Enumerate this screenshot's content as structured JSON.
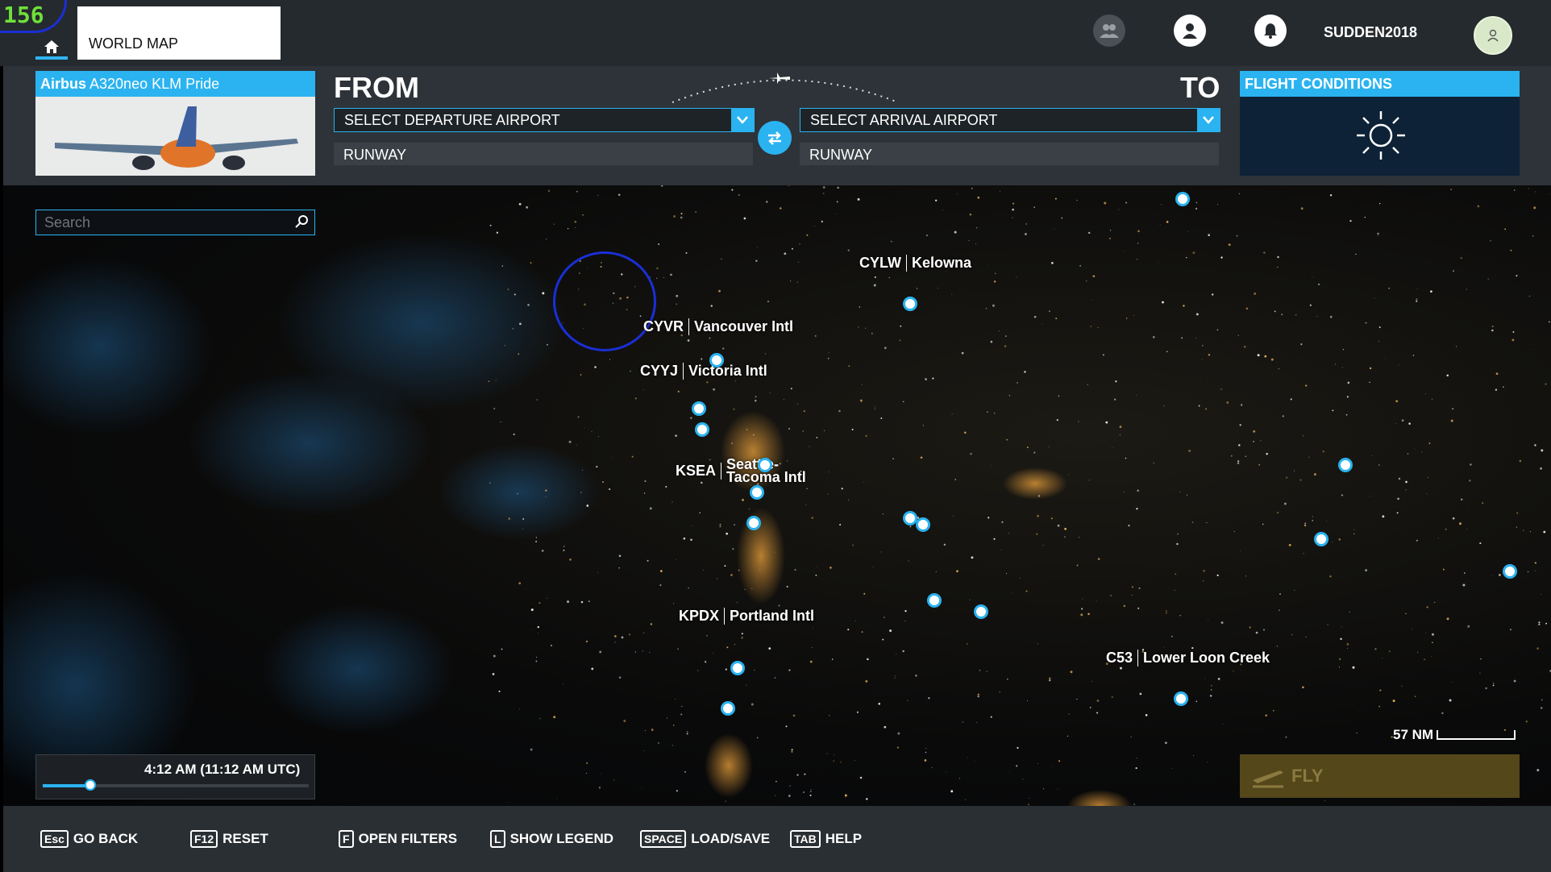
{
  "overlay": {
    "fps": "156"
  },
  "topbar": {
    "tab_label": "WORLD MAP",
    "username": "SUDDEN2018",
    "icons": [
      "home-icon",
      "friends-icon",
      "profile-icon",
      "notifications-icon",
      "avatar-icon"
    ]
  },
  "aircraft": {
    "name_bold": "Airbus",
    "name_rest": " A320neo KLM Pride"
  },
  "flight": {
    "from_label": "FROM",
    "to_label": "TO",
    "departure_placeholder": "SELECT DEPARTURE AIRPORT",
    "arrival_placeholder": "SELECT ARRIVAL AIRPORT",
    "departure_runway": "RUNWAY",
    "arrival_runway": "RUNWAY"
  },
  "conditions": {
    "title": "FLIGHT CONDITIONS",
    "weather_icon": "sun-icon"
  },
  "search": {
    "placeholder": "Search"
  },
  "map": {
    "airports": [
      {
        "code": "CYLW",
        "name": "Kelowna"
      },
      {
        "code": "CYVR",
        "name": "Vancouver Intl"
      },
      {
        "code": "CYYJ",
        "name": "Victoria Intl"
      },
      {
        "code": "KSEA",
        "name": "Seattle-Tacoma Intl"
      },
      {
        "code": "KPDX",
        "name": "Portland Intl"
      },
      {
        "code": "C53",
        "name": "Lower Loon Creek"
      }
    ],
    "scale_label": "57 NM"
  },
  "time": {
    "label": "4:12 AM (11:12 AM UTC)",
    "slider_fraction": 0.18
  },
  "fly": {
    "label": "FLY"
  },
  "bottom_keys": [
    {
      "key": "Esc",
      "label": "GO BACK"
    },
    {
      "key": "F12",
      "label": "RESET"
    },
    {
      "key": "F",
      "label": "OPEN FILTERS"
    },
    {
      "key": "L",
      "label": "SHOW LEGEND"
    },
    {
      "key": "SPACE",
      "label": "LOAD/SAVE"
    },
    {
      "key": "TAB",
      "label": "HELP"
    }
  ],
  "colors": {
    "accent": "#2ab3f0",
    "annotation": "#1a2fd6",
    "fly_bg": "#54471a"
  }
}
